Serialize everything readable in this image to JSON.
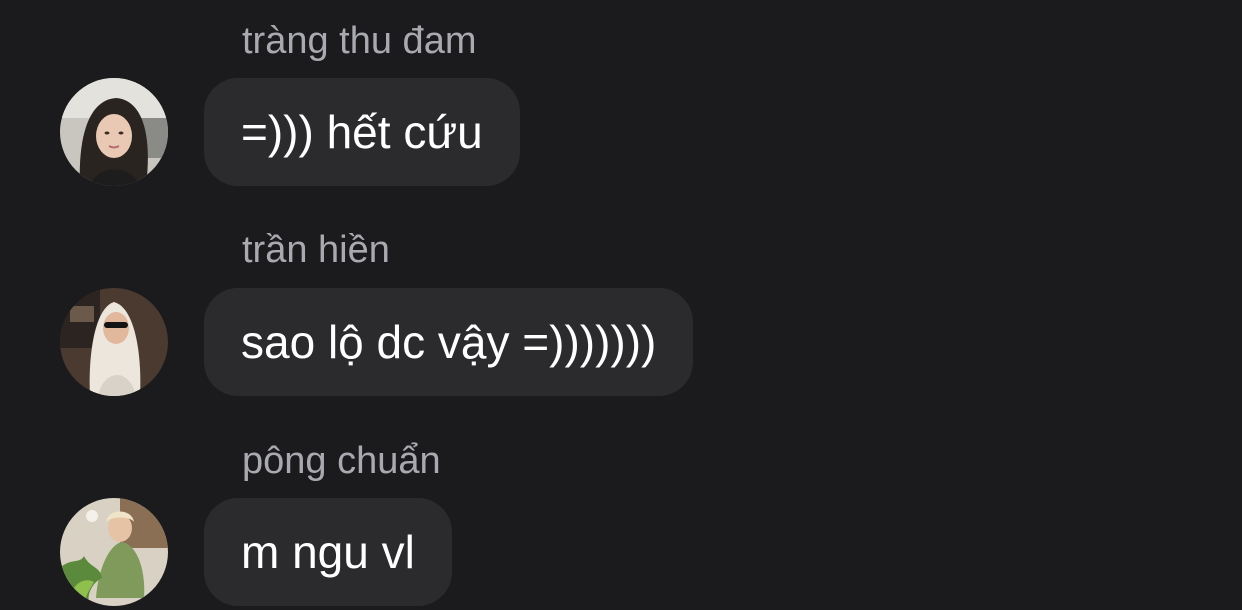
{
  "messages": [
    {
      "sender": "tràng thu đam",
      "text": "=))) hết cứu",
      "avatar_icon": "user-avatar-photo"
    },
    {
      "sender": "trần hiền",
      "text": "sao lộ dc vậy =)))))))",
      "avatar_icon": "user-avatar-photo"
    },
    {
      "sender": "pông chuẩn",
      "text": "m ngu vl",
      "avatar_icon": "user-avatar-photo"
    }
  ],
  "colors": {
    "background": "#1b1b1d",
    "bubble": "#2b2b2e",
    "sender_name": "#a9a9b0",
    "message_text": "#ffffff"
  }
}
